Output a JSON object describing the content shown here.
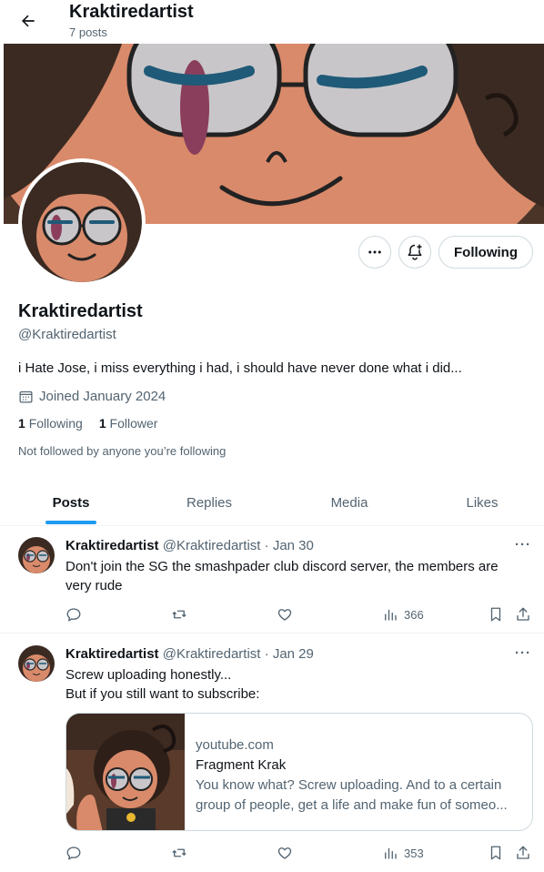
{
  "header": {
    "title": "Kraktiredartist",
    "post_count": "7 posts"
  },
  "profile": {
    "name": "Kraktiredartist",
    "handle": "@Kraktiredartist",
    "bio": "i Hate Jose, i miss everything i had, i should have never done what i did...",
    "joined": "Joined January 2024",
    "following_count": "1",
    "following_label": "Following",
    "followers_count": "1",
    "followers_label": "Follower",
    "not_followed": "Not followed by anyone you’re following",
    "follow_button": "Following"
  },
  "tabs": [
    {
      "label": "Posts",
      "active": true
    },
    {
      "label": "Replies",
      "active": false
    },
    {
      "label": "Media",
      "active": false
    },
    {
      "label": "Likes",
      "active": false
    }
  ],
  "posts": [
    {
      "name": "Kraktiredartist",
      "handle": "@Kraktiredartist",
      "sep": "·",
      "date": "Jan 30",
      "text": "Don't join the SG the smashpader club discord server, the members are very rude",
      "views": "366"
    },
    {
      "name": "Kraktiredartist",
      "handle": "@Kraktiredartist",
      "sep": "·",
      "date": "Jan 29",
      "text_line1": "Screw uploading honestly...",
      "text_line2": "But if you still want to subscribe:",
      "views": "353",
      "card": {
        "domain": "youtube.com",
        "title": "Fragment Krak",
        "description": "You know what? Screw uploading. And to a certain group of people, get a life and make fun of someo..."
      }
    }
  ],
  "colors": {
    "accent": "#1d9bf0",
    "secondary_text": "#536471",
    "border": "#cfd9de",
    "skin": "#d98a6a",
    "hair": "#3a2a22",
    "banner_bg": "#4a3428"
  },
  "icons": [
    "back-arrow-icon",
    "more-icon",
    "bell-plus-icon",
    "calendar-icon",
    "reply-icon",
    "repost-icon",
    "like-icon",
    "views-icon",
    "bookmark-icon",
    "share-icon"
  ]
}
